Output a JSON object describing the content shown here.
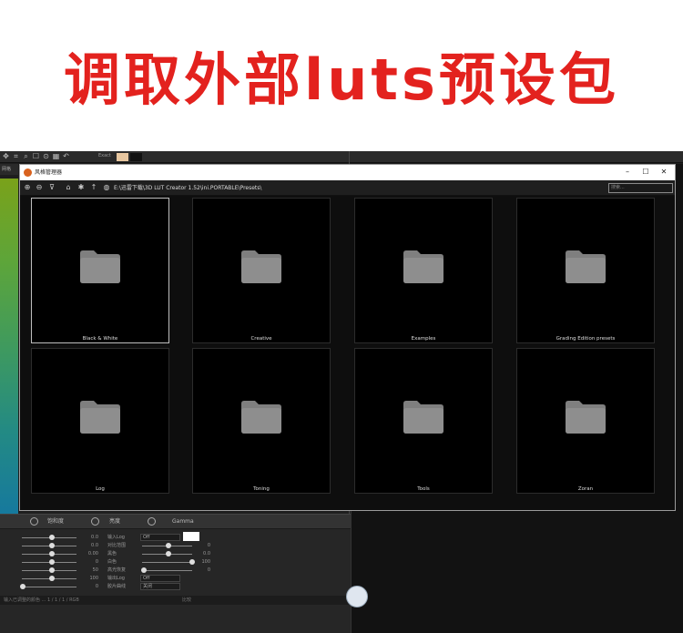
{
  "banner": {
    "title": "调取外部luts预设包"
  },
  "toolbar": {
    "exact_label": "Exact",
    "tools": [
      "move-icon",
      "crop-icon",
      "zoom-icon",
      "hand-icon",
      "picker-icon"
    ],
    "swatch_colors": [
      "#e8c7a0",
      "#111111"
    ]
  },
  "left_panel": {
    "tab_label": "网格"
  },
  "bottom_panel": {
    "bar_items": [
      "饱和度",
      "亮度",
      "Gamma"
    ],
    "slider_values": [
      "0.0",
      "0.0",
      "0.00",
      "0",
      "50",
      "100",
      "0"
    ],
    "fields": [
      {
        "label": "输入Log",
        "value": "Off"
      },
      {
        "label": "对比范围",
        "value": "0"
      },
      {
        "label": "黑色",
        "value": "0.0"
      },
      {
        "label": "白色",
        "value": "100"
      },
      {
        "label": "高光恢复",
        "value": "0"
      },
      {
        "label": "输出Log",
        "value": "Off"
      },
      {
        "label": "胶片曲线",
        "value": "关闭"
      }
    ],
    "status_left": "输入已调整的颜色 ... 1 / 1 / 1 / RGB",
    "status_right": "比较"
  },
  "browser": {
    "title": "风格管理器",
    "path": "E:\\迅雷下载\\3D LUT Creator 1.52\\ini.PORTABLE\\Presets\\",
    "search_placeholder": "搜索...",
    "icons": [
      "zoom-in-icon",
      "zoom-out-icon",
      "filter-icon",
      "home-icon",
      "star-icon",
      "up-icon",
      "globe-icon"
    ],
    "folders": [
      {
        "label": "Black & White",
        "selected": true
      },
      {
        "label": "Creative",
        "selected": false
      },
      {
        "label": "Examples",
        "selected": false
      },
      {
        "label": "Grading Edition presets",
        "selected": false
      },
      {
        "label": "Log",
        "selected": false
      },
      {
        "label": "Toning",
        "selected": false
      },
      {
        "label": "Tools",
        "selected": false
      },
      {
        "label": "Zoran",
        "selected": false
      }
    ]
  }
}
